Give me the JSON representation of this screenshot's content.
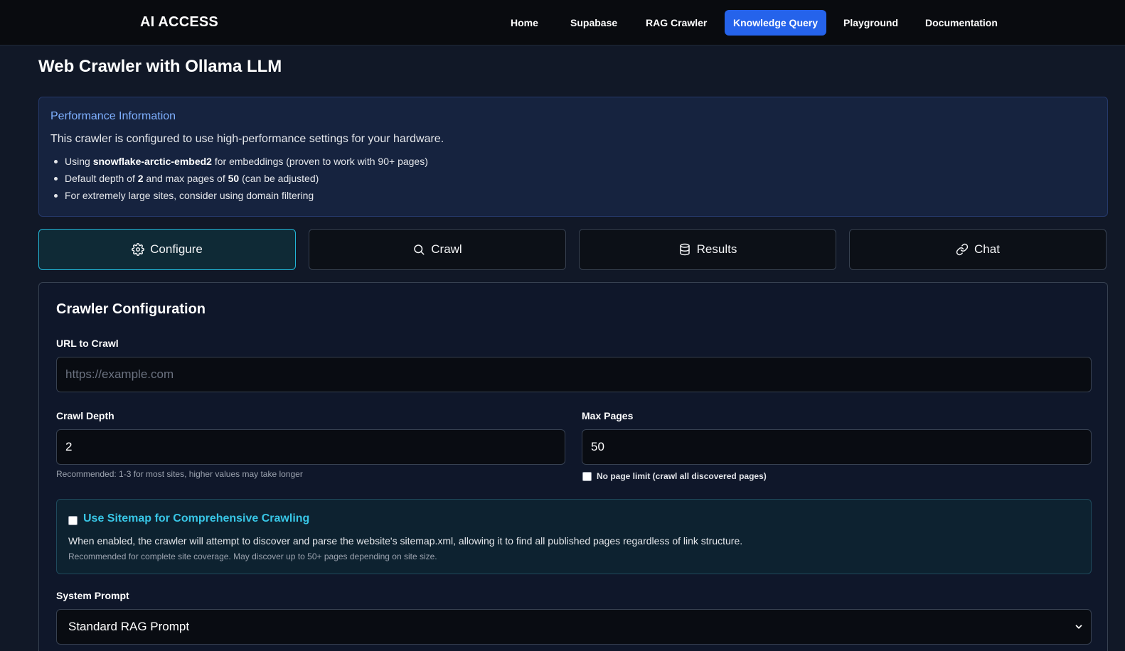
{
  "brand": "AI ACCESS",
  "nav": [
    {
      "label": "Home",
      "active": false
    },
    {
      "label": "Supabase",
      "active": false
    },
    {
      "label": "RAG Crawler",
      "active": false
    },
    {
      "label": "Knowledge Query",
      "active": true
    },
    {
      "label": "Playground",
      "active": false
    },
    {
      "label": "Documentation",
      "active": false
    }
  ],
  "page_title": "Web Crawler with Ollama LLM",
  "info": {
    "title": "Performance Information",
    "text": "This crawler is configured to use high-performance settings for your hardware.",
    "items": [
      {
        "pre": "Using ",
        "bold": "snowflake-arctic-embed2",
        "post": " for embeddings (proven to work with 90+ pages)"
      },
      {
        "pre": "Default depth of ",
        "bold": "2",
        "mid": " and max pages of ",
        "bold2": "50",
        "post": " (can be adjusted)"
      },
      {
        "pre": "For extremely large sites, consider using domain filtering"
      }
    ]
  },
  "tabs": [
    {
      "label": "Configure",
      "icon": "gear-icon",
      "active": true
    },
    {
      "label": "Crawl",
      "icon": "search-icon",
      "active": false
    },
    {
      "label": "Results",
      "icon": "database-icon",
      "active": false
    },
    {
      "label": "Chat",
      "icon": "link-icon",
      "active": false
    }
  ],
  "config": {
    "title": "Crawler Configuration",
    "url_label": "URL to Crawl",
    "url_placeholder": "https://example.com",
    "url_value": "",
    "depth_label": "Crawl Depth",
    "depth_value": "2",
    "depth_hint": "Recommended: 1-3 for most sites, higher values may take longer",
    "max_label": "Max Pages",
    "max_value": "50",
    "no_limit_label": "No page limit (crawl all discovered pages)",
    "no_limit_checked": false,
    "sitemap_title": "Use Sitemap for Comprehensive Crawling",
    "sitemap_checked": false,
    "sitemap_text": "When enabled, the crawler will attempt to discover and parse the website's sitemap.xml, allowing it to find all published pages regardless of link structure.",
    "sitemap_hint": "Recommended for complete site coverage. May discover up to 50+ pages depending on site size.",
    "prompt_label": "System Prompt",
    "prompt_value": "Standard RAG Prompt"
  }
}
